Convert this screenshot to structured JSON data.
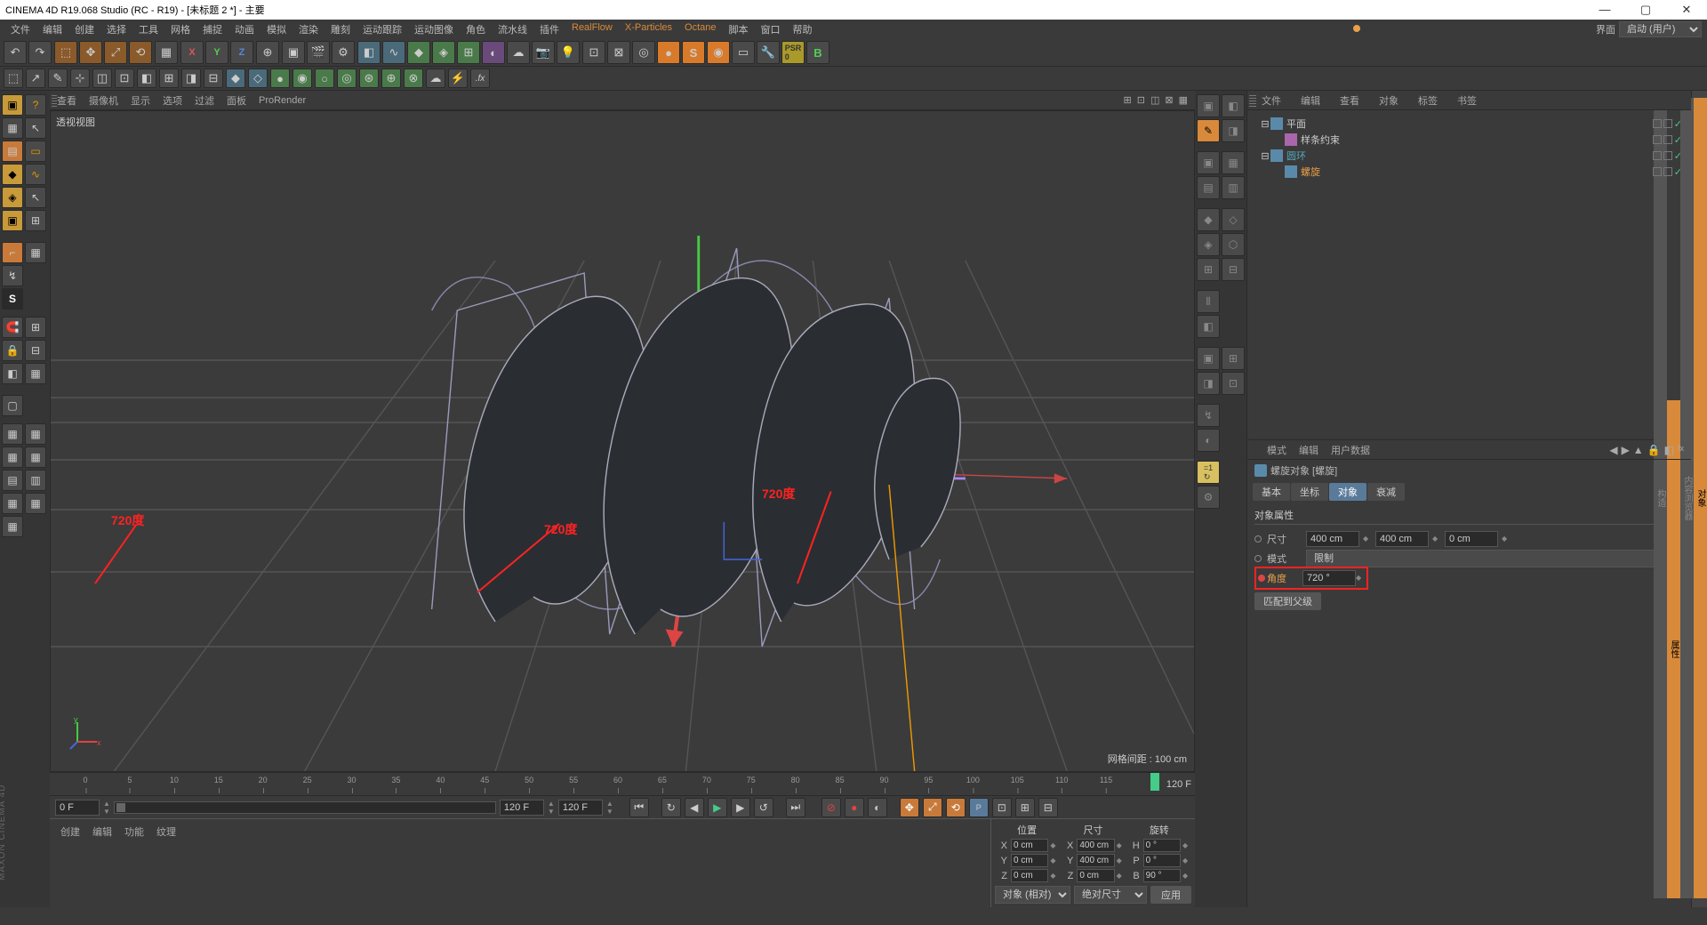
{
  "title": "CINEMA 4D R19.068 Studio (RC - R19) - [未标题 2 *] - 主要",
  "menu": [
    "文件",
    "编辑",
    "创建",
    "选择",
    "工具",
    "网格",
    "捕捉",
    "动画",
    "模拟",
    "渲染",
    "雕刻",
    "运动跟踪",
    "运动图像",
    "角色",
    "流水线",
    "插件",
    "RealFlow",
    "X-Particles",
    "Octane",
    "脚本",
    "窗口",
    "帮助"
  ],
  "layout_label": "界面",
  "layout_value": "启动 (用户)",
  "vp_tabs": [
    "查看",
    "摄像机",
    "显示",
    "选项",
    "过滤",
    "面板",
    "ProRender"
  ],
  "vp_label": "透视视图",
  "grid_info": "网格间距 : 100 cm",
  "anno": "720度",
  "rp_tabs": [
    "文件",
    "编辑",
    "查看",
    "对象",
    "标签",
    "书签"
  ],
  "tree": [
    {
      "indent": 0,
      "toggle": "⊟",
      "label": "平面",
      "cls": ""
    },
    {
      "indent": 1,
      "toggle": "",
      "label": "样条约束",
      "cls": "",
      "purple": true
    },
    {
      "indent": 0,
      "toggle": "⊟",
      "label": "圆环",
      "cls": "cyan"
    },
    {
      "indent": 1,
      "toggle": "",
      "label": "螺旋",
      "cls": "orange"
    }
  ],
  "attr_header": [
    "模式",
    "编辑",
    "用户数据"
  ],
  "attr_title": "螺旋对象 [螺旋]",
  "attr_tabs": [
    "基本",
    "坐标",
    "对象",
    "衰减"
  ],
  "attr_section": "对象属性",
  "size_label": "尺寸",
  "size_vals": [
    "400 cm",
    "400 cm",
    "0 cm"
  ],
  "mode_label": "模式",
  "mode_value": "限制",
  "angle_label": "角度",
  "angle_value": "720 °",
  "match_btn": "匹配到父级",
  "timeline": {
    "start": 0,
    "end": 120,
    "ticks": [
      0,
      5,
      10,
      15,
      20,
      25,
      30,
      35,
      40,
      45,
      50,
      55,
      60,
      65,
      70,
      75,
      80,
      85,
      90,
      95,
      100,
      105,
      110,
      115
    ],
    "end_label": "120 F"
  },
  "tlc": {
    "f1": "0 F",
    "f2": "0 F",
    "f3": "120 F",
    "f4": "120 F"
  },
  "bp_tabs": [
    "创建",
    "编辑",
    "功能",
    "纹理"
  ],
  "coord_headers": [
    "位置",
    "尺寸",
    "旋转"
  ],
  "coord": {
    "X": {
      "p": "0 cm",
      "s": "400 cm",
      "r": "0 °",
      "rl": "H"
    },
    "Y": {
      "p": "0 cm",
      "s": "400 cm",
      "r": "0 °",
      "rl": "P"
    },
    "Z": {
      "p": "0 cm",
      "s": "0 cm",
      "r": "90 °",
      "rl": "B"
    }
  },
  "coord_dd1": "对象 (相对)",
  "coord_dd2": "绝对尺寸",
  "apply": "应用",
  "watermark": "MAXON CINEMA 4D",
  "far_tabs": [
    "属性",
    "构造"
  ]
}
